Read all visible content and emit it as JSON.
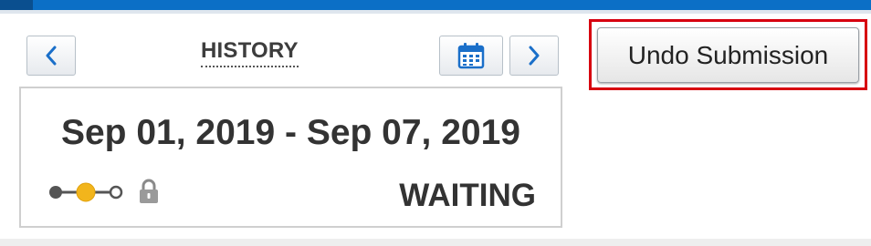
{
  "header": {
    "title": "HISTORY"
  },
  "period": {
    "range": "Sep 01, 2019 - Sep 07, 2019",
    "status": "WAITING"
  },
  "actions": {
    "undo_label": "Undo Submission"
  },
  "icons": {
    "prev": "chevron-left-icon",
    "next": "chevron-right-icon",
    "calendar": "calendar-icon",
    "progress": "progress-steps-icon",
    "lock": "lock-icon"
  },
  "colors": {
    "accent": "#1a6fc9",
    "highlight": "#d7000f",
    "step_done": "#555555",
    "step_current": "#f2b51c",
    "step_pending": "#ffffff"
  }
}
